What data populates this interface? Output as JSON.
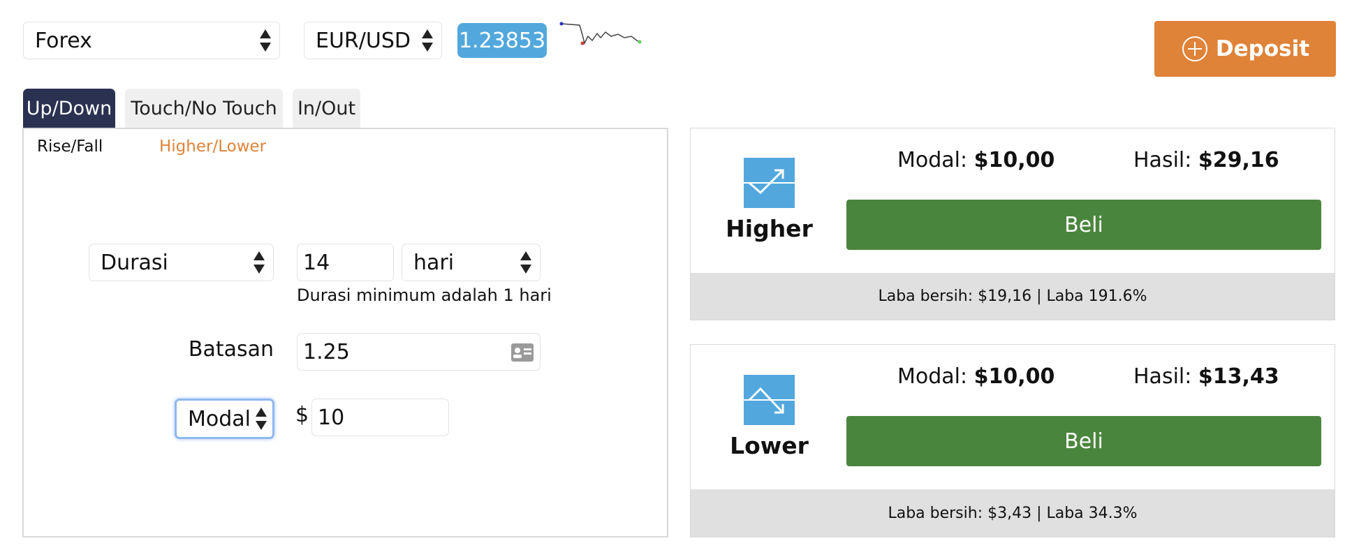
{
  "toolbar": {
    "market": "Forex",
    "pair": "EUR/USD",
    "price": "1.23853",
    "deposit_label": "Deposit"
  },
  "tabs": [
    {
      "label": "Up/Down",
      "active": true
    },
    {
      "label": "Touch/No Touch",
      "active": false
    },
    {
      "label": "In/Out",
      "active": false
    }
  ],
  "subtabs": {
    "rise_fall": "Rise/Fall",
    "higher_lower": "Higher/Lower"
  },
  "form": {
    "duration_type": "Durasi",
    "duration_value": "14",
    "duration_unit": "hari",
    "duration_hint": "Durasi minimum adalah 1 hari",
    "barrier_label": "Batasan",
    "barrier_value": "1.25",
    "stake_type": "Modal",
    "currency": "$",
    "stake_value": "10"
  },
  "contracts": [
    {
      "name": "Higher",
      "stake_label": "Modal:",
      "stake_currency": "$",
      "stake_amount": "10,00",
      "payout_label": "Hasil:",
      "payout_currency": "$",
      "payout_amount": "29,16",
      "buy_label": "Beli",
      "footer": "Laba bersih: $19,16 | Laba 191.6%"
    },
    {
      "name": "Lower",
      "stake_label": "Modal:",
      "stake_currency": "$",
      "stake_amount": "10,00",
      "payout_label": "Hasil:",
      "payout_currency": "$",
      "payout_amount": "13,43",
      "buy_label": "Beli",
      "footer": "Laba bersih: $3,43 | Laba 34.3%"
    }
  ],
  "colors": {
    "accent_orange": "#df8339",
    "price_blue": "#52a8dd",
    "active_tab": "#2b3151",
    "buy_green": "#4a853d"
  },
  "icons": {
    "sparkline": "price-sparkline-icon",
    "deposit": "plus-circle-icon",
    "higher": "trend-up-icon",
    "lower": "trend-down-icon",
    "barrier": "id-card-icon"
  }
}
